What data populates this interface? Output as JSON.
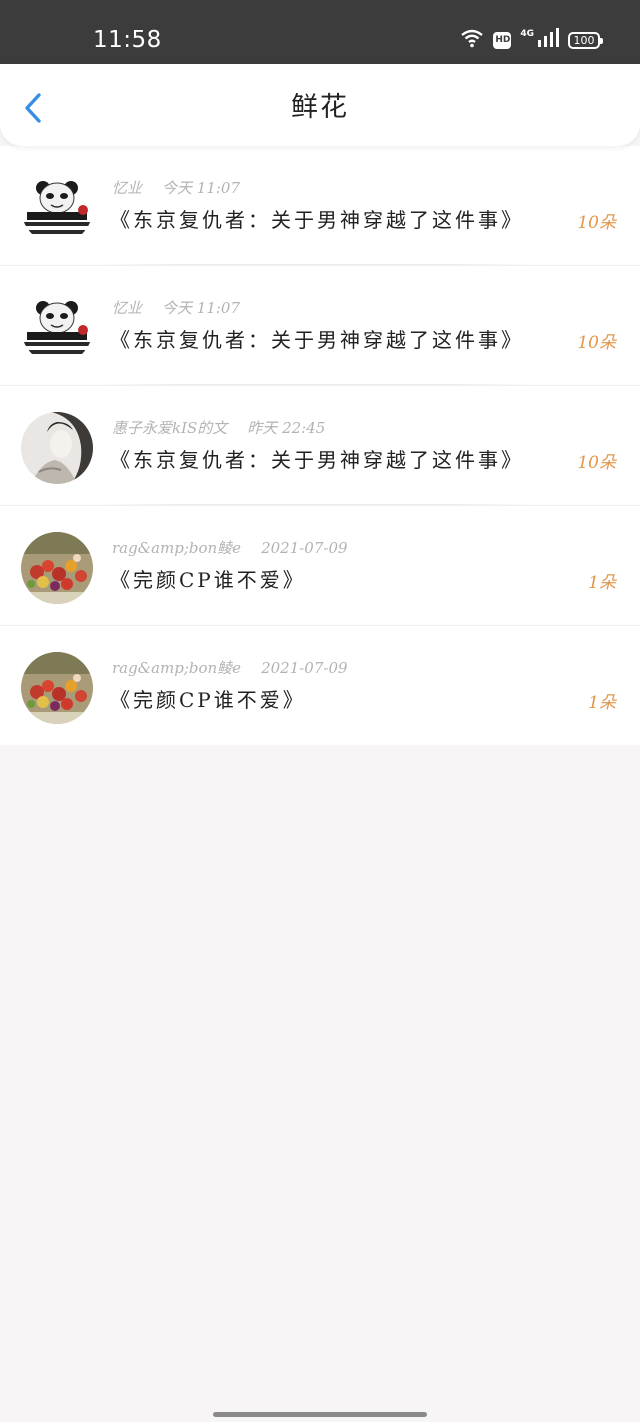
{
  "status_bar": {
    "time": "11:58",
    "hd": "HD",
    "network": "4G",
    "battery": "100",
    "icons": [
      "wifi-icon",
      "hd-icon",
      "signal-icon",
      "battery-icon"
    ]
  },
  "nav": {
    "title": "鲜花",
    "back_icon": "chevron-left-icon"
  },
  "colors": {
    "accent_back": "#3a8ee6",
    "count": "#e2964a",
    "meta": "#b3b3b3",
    "status_bar_bg": "#3c3c3c"
  },
  "items": [
    {
      "user": "忆业",
      "time": "今天 11:07",
      "title": "《东京复仇者：关于男神穿越了这件事》",
      "count": "10朵",
      "avatar": "panda-meme-avatar"
    },
    {
      "user": "忆业",
      "time": "今天 11:07",
      "title": "《东京复仇者：关于男神穿越了这件事》",
      "count": "10朵",
      "avatar": "panda-meme-avatar"
    },
    {
      "user": "惠子永爱kIS的文",
      "time": "昨天 22:45",
      "title": "《东京复仇者：关于男神穿越了这件事》",
      "count": "10朵",
      "avatar": "ink-portrait-avatar"
    },
    {
      "user": "rag&amp;bon鲮e",
      "time": "2021-07-09",
      "title": "《完颜CP谁不爱》",
      "count": "1朵",
      "avatar": "berries-avatar"
    },
    {
      "user": "rag&amp;bon鲮e",
      "time": "2021-07-09",
      "title": "《完颜CP谁不爱》",
      "count": "1朵",
      "avatar": "berries-avatar"
    }
  ]
}
